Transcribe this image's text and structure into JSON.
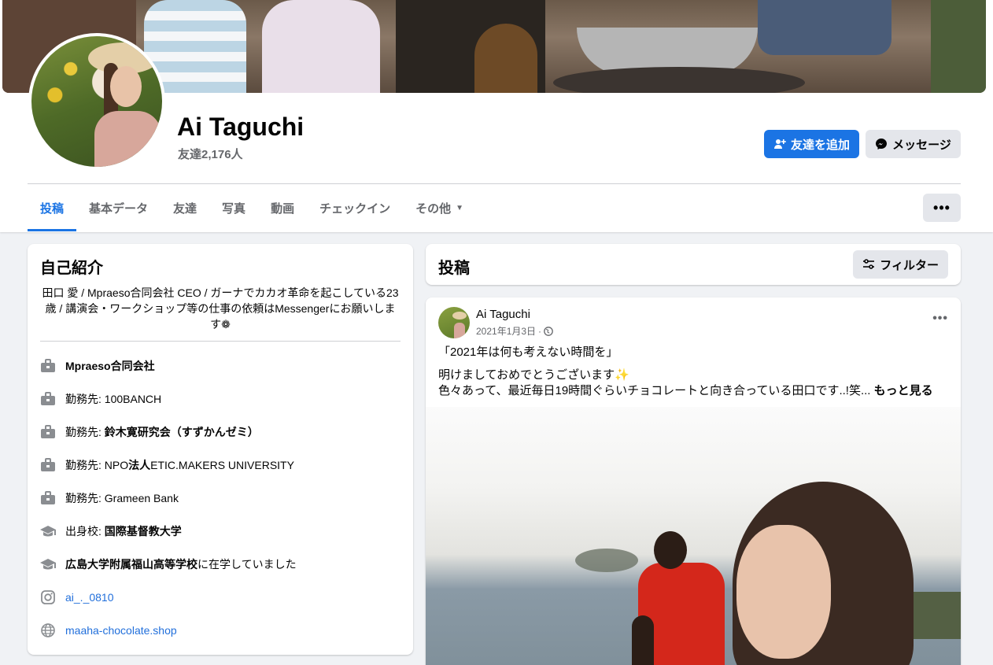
{
  "profile": {
    "name": "Ai Taguchi",
    "friend_count": "友達2,176人",
    "add_friend_label": "友達を追加",
    "message_label": "メッセージ"
  },
  "tabs": [
    {
      "label": "投稿",
      "active": true
    },
    {
      "label": "基本データ"
    },
    {
      "label": "友達"
    },
    {
      "label": "写真"
    },
    {
      "label": "動画"
    },
    {
      "label": "チェックイン"
    },
    {
      "label": "その他"
    }
  ],
  "more_label": "•••",
  "intro": {
    "title": "自己紹介",
    "bio": "田口 愛 / Mpraeso合同会社 CEO / ガーナでカカオ革命を起こしている23歳 / 講演会・ワークショップ等の仕事の依頼はMessengerにお願いします❁",
    "items": [
      {
        "icon": "briefcase-icon",
        "prefix": "",
        "bold": "Mpraeso合同会社",
        "suffix": ""
      },
      {
        "icon": "briefcase-icon",
        "prefix": "勤務先: ",
        "bold": "",
        "suffix": "100BANCH"
      },
      {
        "icon": "briefcase-icon",
        "prefix": "勤務先: ",
        "bold": "鈴木寛研究会（すずかんゼミ）",
        "suffix": ""
      },
      {
        "icon": "briefcase-icon",
        "prefix": "勤務先: NPO",
        "bold": "法人",
        "suffix": "ETIC.MAKERS UNIVERSITY"
      },
      {
        "icon": "briefcase-icon",
        "prefix": "勤務先: ",
        "bold": "",
        "suffix": "Grameen Bank"
      },
      {
        "icon": "graduation-cap-icon",
        "prefix": "出身校: ",
        "bold": "国際基督教大学",
        "suffix": ""
      },
      {
        "icon": "graduation-cap-icon",
        "prefix": "",
        "bold": "広島大学附属福山高等学校",
        "suffix": "に在学していました"
      },
      {
        "icon": "instagram-icon",
        "link": "ai_._0810"
      },
      {
        "icon": "globe-icon",
        "link": "maaha-chocolate.shop"
      }
    ]
  },
  "posts": {
    "title": "投稿",
    "filter_label": "フィルター",
    "post": {
      "author": "Ai Taguchi",
      "date": "2021年1月3日",
      "date_separator": "·",
      "line1": "「2021年は何も考えない時間を」",
      "line2": "明けましておめでとうございます✨",
      "line3": "色々あって、最近毎日19時間ぐらいチョコレートと向き合っている田口です..!笑...",
      "see_more": "もっと見る",
      "more_label": "•••"
    }
  },
  "colors": {
    "accent": "#1b74e4",
    "link": "#216fdb",
    "muted": "#65676b"
  }
}
